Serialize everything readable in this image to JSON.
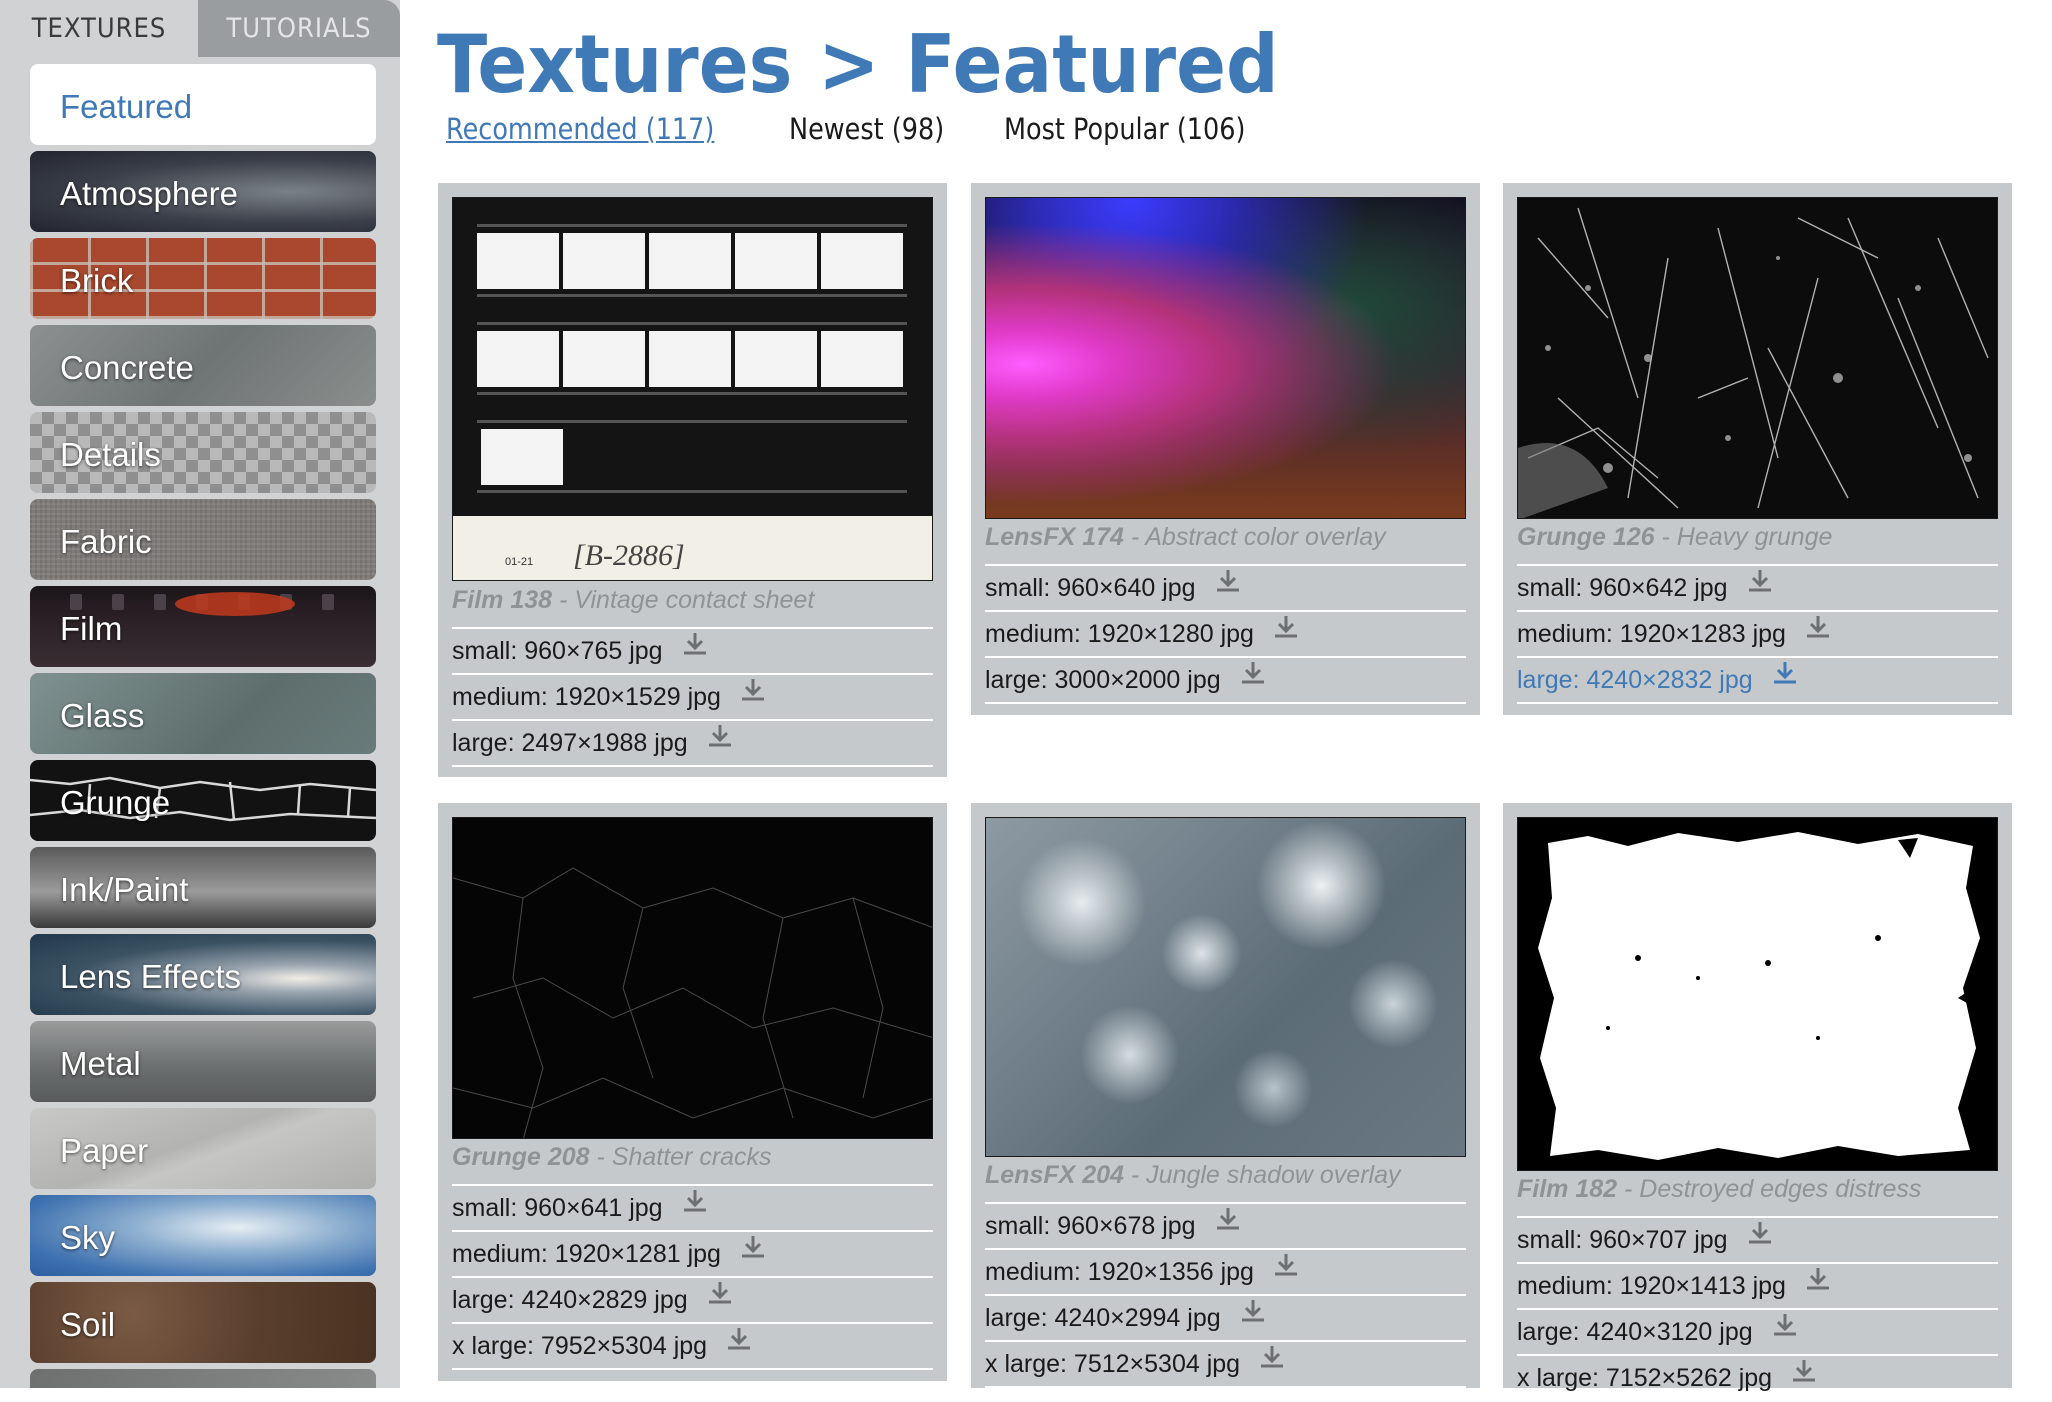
{
  "sidebar": {
    "tabs": [
      {
        "label": "TEXTURES",
        "active": true
      },
      {
        "label": "TUTORIALS",
        "active": false
      }
    ],
    "categories": [
      {
        "label": "Featured",
        "active": true
      },
      {
        "label": "Atmosphere"
      },
      {
        "label": "Brick"
      },
      {
        "label": "Concrete"
      },
      {
        "label": "Details"
      },
      {
        "label": "Fabric"
      },
      {
        "label": "Film"
      },
      {
        "label": "Glass"
      },
      {
        "label": "Grunge"
      },
      {
        "label": "Ink/Paint"
      },
      {
        "label": "Lens Effects"
      },
      {
        "label": "Metal"
      },
      {
        "label": "Paper"
      },
      {
        "label": "Sky"
      },
      {
        "label": "Soil"
      }
    ]
  },
  "main": {
    "title": "Textures > Featured",
    "subtabs": [
      {
        "label": "Recommended (117)",
        "active": true
      },
      {
        "label": "Newest (98)"
      },
      {
        "label": "Most Popular (106)"
      }
    ],
    "cards": [
      {
        "name": "Film 138",
        "desc": " - Vintage contact sheet",
        "thumb_text": [
          "01-21",
          "[B-2886]"
        ],
        "downloads": [
          "small: 960×765 jpg",
          "medium: 1920×1529 jpg",
          "large: 2497×1988 jpg"
        ]
      },
      {
        "name": "LensFX 174",
        "desc": " - Abstract color overlay",
        "downloads": [
          "small: 960×640 jpg",
          "medium: 1920×1280 jpg",
          "large: 3000×2000 jpg"
        ]
      },
      {
        "name": "Grunge 126",
        "desc": " - Heavy grunge",
        "downloads": [
          "small: 960×642 jpg",
          "medium: 1920×1283 jpg",
          "large: 4240×2832 jpg"
        ],
        "hover_index": 2
      },
      {
        "name": "Grunge 208",
        "desc": " - Shatter cracks",
        "downloads": [
          "small: 960×641 jpg",
          "medium: 1920×1281 jpg",
          "large: 4240×2829 jpg",
          "x large: 7952×5304 jpg"
        ]
      },
      {
        "name": "LensFX 204",
        "desc": " - Jungle shadow overlay",
        "downloads": [
          "small: 960×678 jpg",
          "medium: 1920×1356 jpg",
          "large: 4240×2994 jpg",
          "x large: 7512×5304 jpg"
        ]
      },
      {
        "name": "Film 182",
        "desc": " - Destroyed edges distress",
        "downloads": [
          "small: 960×707 jpg",
          "medium: 1920×1413 jpg",
          "large: 4240×3120 jpg",
          "x large: 7152×5262 jpg"
        ]
      }
    ]
  },
  "icons": {
    "download": "download-icon"
  },
  "colors": {
    "accent": "#3f79b6",
    "card_bg": "#c6c9cb",
    "sidebar_bg": "#d0d2d4",
    "caption": "#8f9396"
  }
}
